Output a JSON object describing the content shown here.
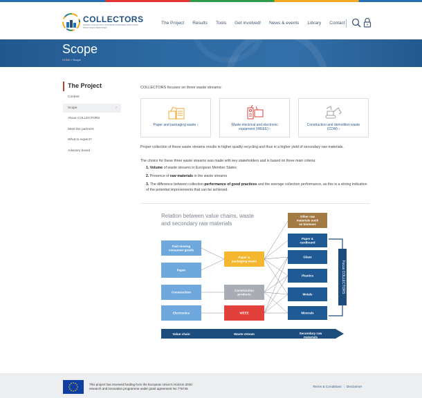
{
  "brand": {
    "title": "COLLECTORS",
    "subtitle": "WASTE COLLECTION SYSTEMS ASSESSED AND GOOD PRACTICES IDENTIFIED"
  },
  "nav": {
    "items": [
      "The Project",
      "Results",
      "Tools",
      "Get involved!",
      "News & events",
      "Library",
      "Contact"
    ]
  },
  "icons": {
    "search": "search-icon",
    "lock": "lock-icon"
  },
  "banner": {
    "title": "Scope",
    "crumb_home": "HOME",
    "crumb_sep": "/",
    "crumb_current": "Scope"
  },
  "sidebar": {
    "title": "The Project",
    "items": [
      "Context",
      "Scope",
      "About COLLECTORS",
      "Meet the partners",
      "What to expect?",
      "Advisory board"
    ],
    "active_index": 1
  },
  "content": {
    "intro": "COLLECTORS focuses on three waste streams:",
    "cards": [
      "Paper and packaging waste ›",
      "Waste electrical and electronic equipment (WEEE) ›",
      "Construction and demolition waste (CDW) ›"
    ],
    "para1": "Proper collection of these waste streams results in higher quality recycling and thus in a higher yield of secondary raw materials.",
    "para2": "The choice for these three waste streams was made with key stakeholders and is based on three main criteria:",
    "criteria": [
      {
        "num": "1.",
        "bold": "Volume",
        "rest": " of waste streams in European Member States"
      },
      {
        "num": "2.",
        "pre": "Presence of ",
        "bold": "raw materials",
        "rest": " in the waste streams"
      },
      {
        "num": "3.",
        "pre": "The difference between collection ",
        "bold": "performance of good practices",
        "rest": " and the average collection performance, as this is a strong indication of the potential improvements that can be achieved."
      }
    ]
  },
  "diagram": {
    "title_line1": "Relation between value chains, waste",
    "title_line2": "and secondary raw materials",
    "value_chains": [
      "Fast moving consumer goods",
      "Paper",
      "Construction",
      "Electronics"
    ],
    "waste_streams": [
      "Paper & packaging waste",
      "Construction products",
      "WEEE"
    ],
    "raw_materials": [
      "Paper & cardboard",
      "Glass",
      "Plastics",
      "Metals",
      "Minerals"
    ],
    "other_materials": "Other raw materials such as biomass",
    "focus_label": "Focus COLLECTORS",
    "axis": [
      "Value chain",
      "Waste stream",
      "Secondary raw materials"
    ],
    "colors": {
      "value_chain": "#6fa8dc",
      "paper_waste": "#f4b72f",
      "construction": "#a8adb3",
      "weee": "#e2403a",
      "raw": "#1f5a95",
      "other": "#a47a44",
      "arrow": "#1d4d7d"
    }
  },
  "footer": {
    "funding_line1": "This project has received funding from the European Union's Horizon 2020",
    "funding_line2": "research and innovation programme under grant agreement No 776745",
    "terms": "Terms & Conditions",
    "sep": "|",
    "disclaimer": "Disclaimer"
  }
}
